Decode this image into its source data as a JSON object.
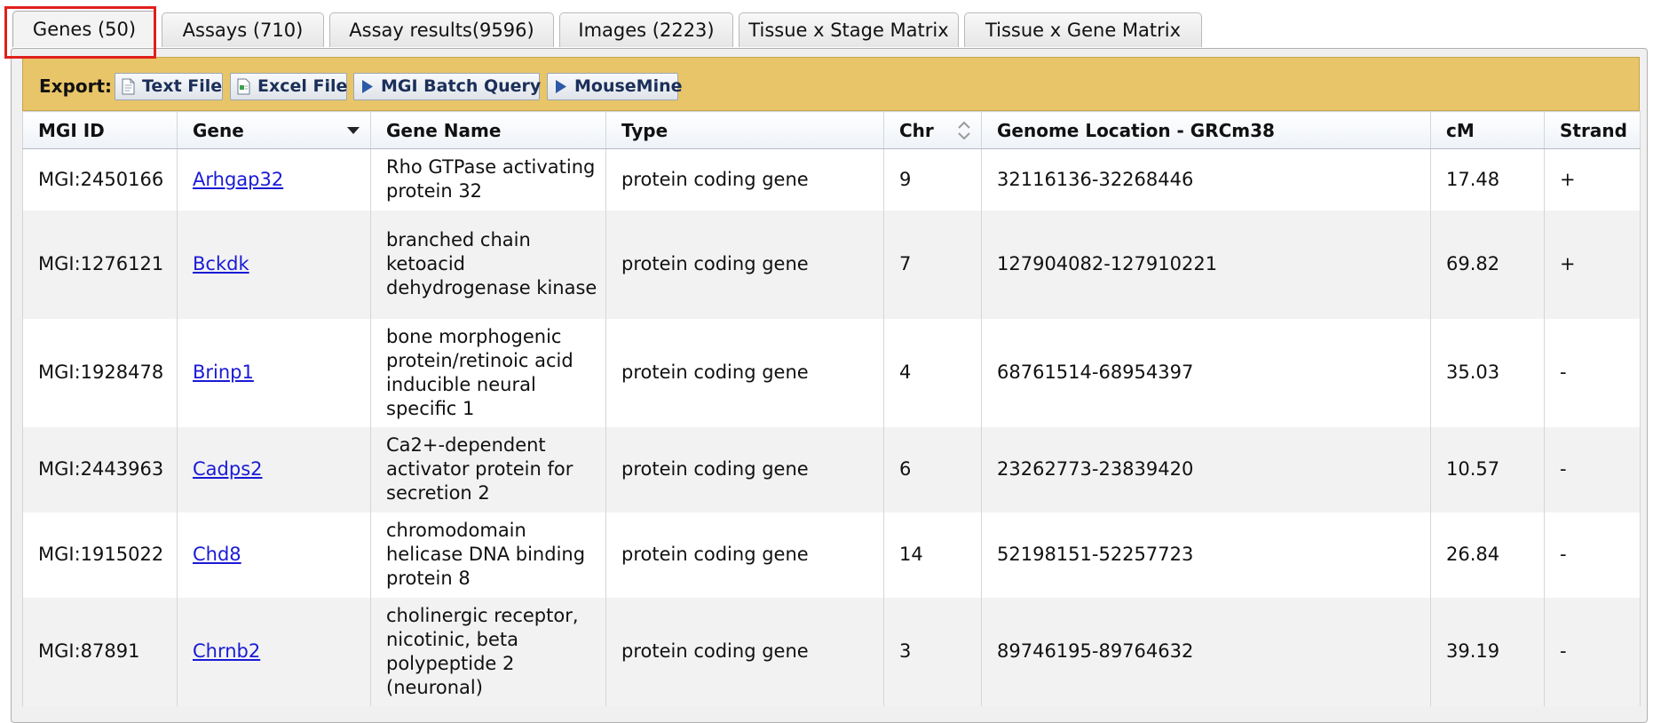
{
  "tabs": [
    {
      "label": "Genes (50)",
      "active": true
    },
    {
      "label": "Assays (710)"
    },
    {
      "label": "Assay results(9596)"
    },
    {
      "label": "Images (2223)"
    },
    {
      "label": "Tissue x Stage Matrix"
    },
    {
      "label": "Tissue x Gene Matrix"
    }
  ],
  "export": {
    "label": "Export:",
    "buttons": [
      "Text File",
      "Excel File",
      "MGI Batch Query",
      "MouseMine"
    ]
  },
  "table": {
    "columns": [
      "MGI ID",
      "Gene",
      "Gene Name",
      "Type",
      "Chr",
      "Genome Location - GRCm38",
      "cM",
      "Strand"
    ],
    "rows": [
      {
        "mgi_id": "MGI:2450166",
        "gene": "Arhgap32",
        "gene_name": "Rho GTPase activating protein 32",
        "type": "protein coding gene",
        "chr": "9",
        "location": "32116136-32268446",
        "cm": "17.48",
        "strand": "+"
      },
      {
        "mgi_id": "MGI:1276121",
        "gene": "Bckdk",
        "gene_name": "branched chain ketoacid dehydrogenase kinase",
        "type": "protein coding gene",
        "chr": "7",
        "location": "127904082-127910221",
        "cm": "69.82",
        "strand": "+"
      },
      {
        "mgi_id": "MGI:1928478",
        "gene": "Brinp1",
        "gene_name": "bone morphogenic protein/retinoic acid inducible neural specific 1",
        "type": "protein coding gene",
        "chr": "4",
        "location": "68761514-68954397",
        "cm": "35.03",
        "strand": "-"
      },
      {
        "mgi_id": "MGI:2443963",
        "gene": "Cadps2",
        "gene_name": "Ca2+-dependent activator protein for secretion 2",
        "type": "protein coding gene",
        "chr": "6",
        "location": "23262773-23839420",
        "cm": "10.57",
        "strand": "-"
      },
      {
        "mgi_id": "MGI:1915022",
        "gene": "Chd8",
        "gene_name": "chromodomain helicase DNA binding protein 8",
        "type": "protein coding gene",
        "chr": "14",
        "location": "52198151-52257723",
        "cm": "26.84",
        "strand": "-"
      },
      {
        "mgi_id": "MGI:87891",
        "gene": "Chrnb2",
        "gene_name": "cholinergic receptor, nicotinic, beta polypeptide 2 (neuronal)",
        "type": "protein coding gene",
        "chr": "3",
        "location": "89746195-89764632",
        "cm": "39.19",
        "strand": "-"
      }
    ]
  },
  "colors": {
    "export_bar": "#e8c568",
    "link": "#1a1ad6",
    "highlight": "#e0201c"
  }
}
